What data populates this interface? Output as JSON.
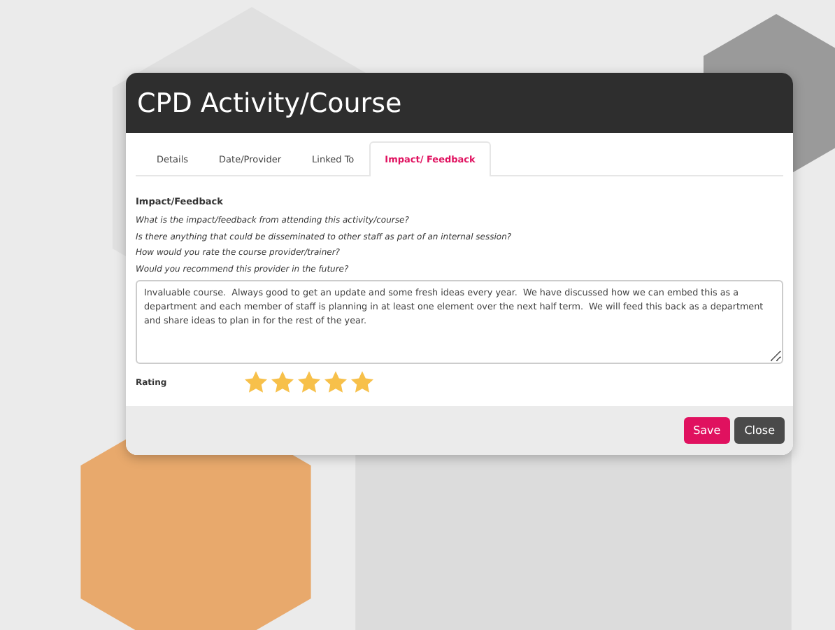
{
  "dialog": {
    "title": "CPD Activity/Course",
    "tabs": [
      {
        "label": "Details",
        "selected": false
      },
      {
        "label": "Date/Provider",
        "selected": false
      },
      {
        "label": "Linked To",
        "selected": false
      },
      {
        "label": "Impact/ Feedback",
        "selected": true
      }
    ],
    "section_title": "Impact/Feedback",
    "questions": [
      "What is the impact/feedback from attending this activity/course?",
      "Is there anything that could be disseminated to other staff as part of an internal session?",
      "How would you rate the course provider/trainer?",
      "Would you recommend this provider in the future?"
    ],
    "feedback": "Invaluable course.  Always good to get an update and some fresh ideas every year.  We have discussed how we can embed this as a department and each member of staff is planning in at least one element over the next half term.  We will feed this back as a department and share ideas to plan in for the rest of the year.",
    "rating": {
      "label": "Rating",
      "stars": 5
    },
    "buttons": [
      {
        "label": "Save",
        "kind": "primary"
      },
      {
        "label": "Close",
        "kind": "secondary"
      }
    ]
  }
}
